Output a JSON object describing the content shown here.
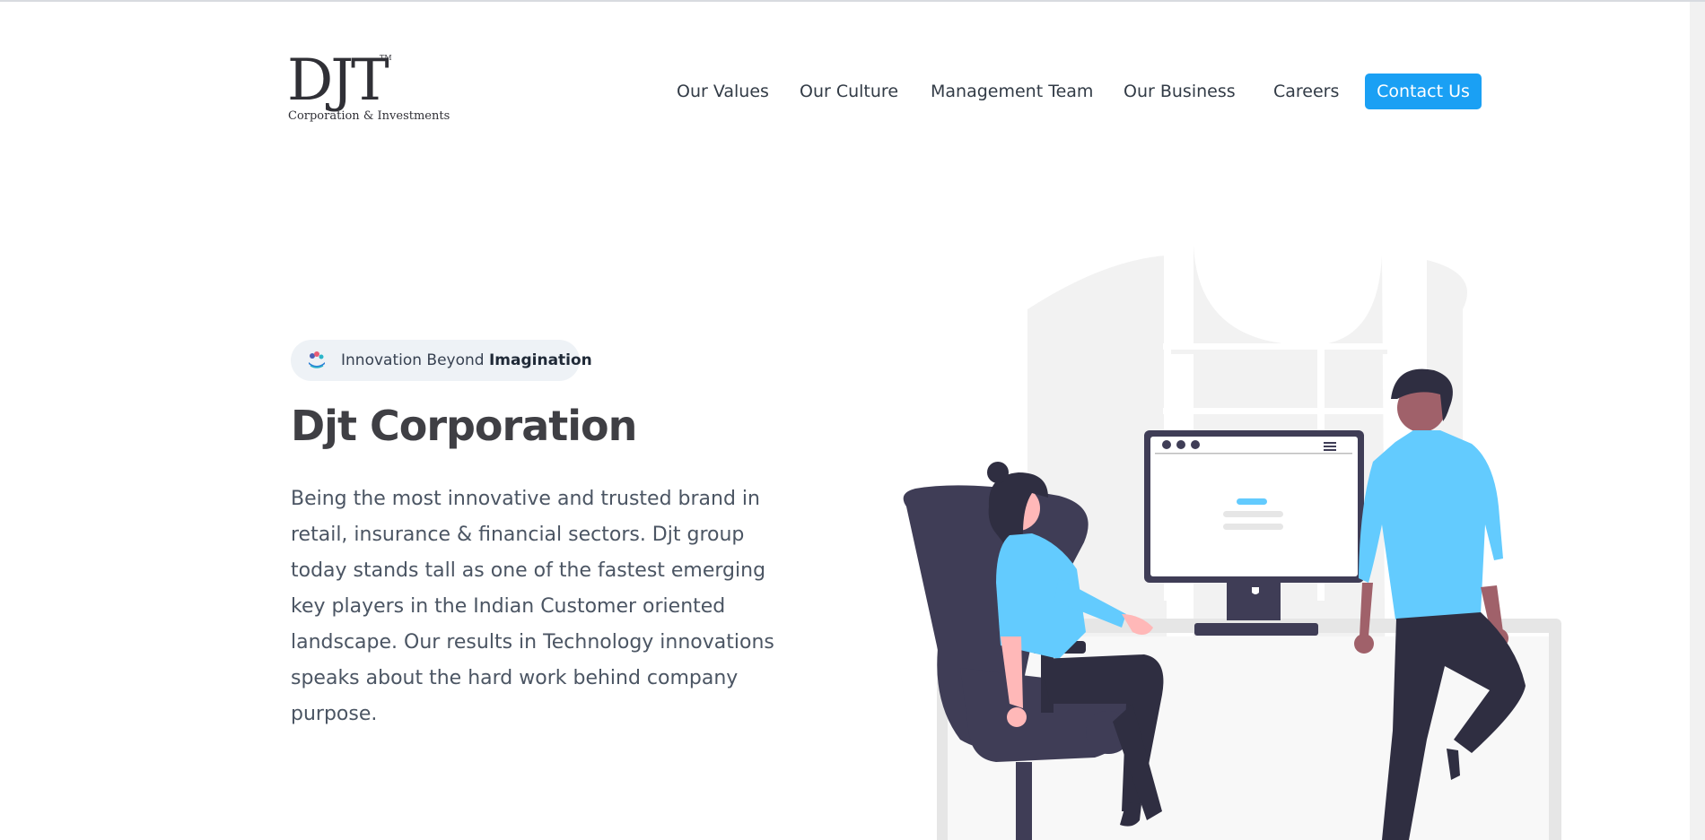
{
  "header": {
    "logo": {
      "mark": "DJT",
      "tm": "TM",
      "subtitle": "Corporation & Investments"
    },
    "nav": [
      {
        "label": "Our Values"
      },
      {
        "label": "Our Culture"
      },
      {
        "label": "Management Team"
      },
      {
        "label": "Our Business"
      },
      {
        "label": "Careers"
      }
    ],
    "contact_label": "Contact Us"
  },
  "hero": {
    "badge": {
      "prefix": "Innovation Beyond ",
      "emphasis": "Imagination"
    },
    "title": "Djt Corporation",
    "description": "Being the most innovative and trusted brand in retail, insurance & financial sectors. Djt group today stands tall as one of the fastest emerging key players in the Indian Customer oriented landscape. Our results in Technology innovations speaks about the hard work behind company purpose."
  },
  "colors": {
    "accent": "#1aa0f4",
    "illustration_blue": "#63cbfe",
    "illustration_dark": "#3f3d56"
  }
}
